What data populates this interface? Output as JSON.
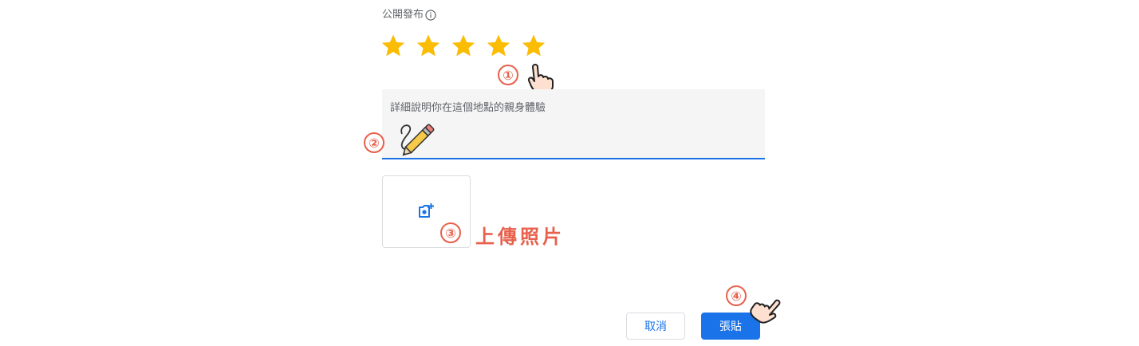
{
  "review": {
    "public_label": "公開發布",
    "rating": 5,
    "max_rating": 5,
    "star_color": "#fbbc04",
    "textarea_placeholder": "詳細說明你在這個地點的親身體驗",
    "upload_annotation": "上傳照片",
    "cancel_label": "取消",
    "post_label": "張貼",
    "accent_color": "#1a73e8",
    "annotation_color": "#e8604c"
  },
  "markers": [
    "①",
    "②",
    "③",
    "④"
  ]
}
